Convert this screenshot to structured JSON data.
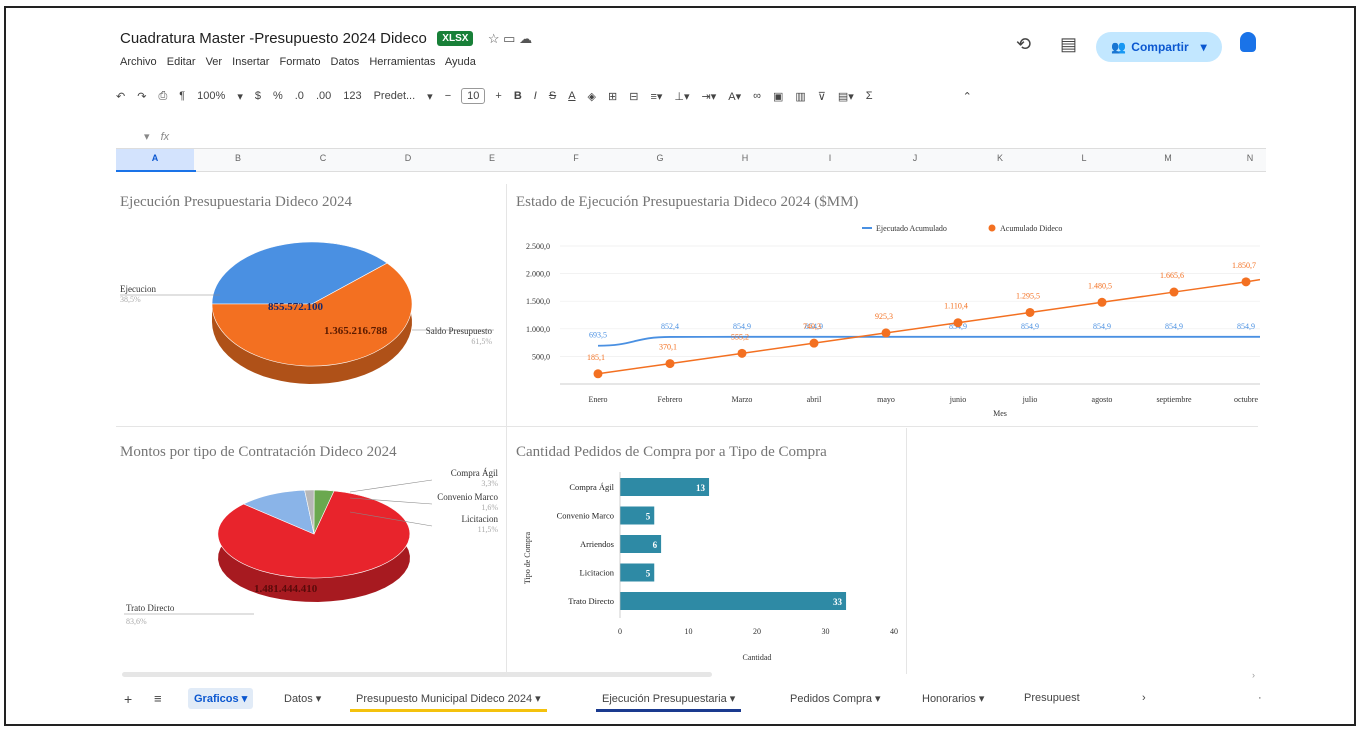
{
  "doc": {
    "title": "Cuadratura Master -Presupuesto 2024 Dideco",
    "file_badge": "XLSX",
    "menu": [
      "Archivo",
      "Editar",
      "Ver",
      "Insertar",
      "Formato",
      "Datos",
      "Herramientas",
      "Ayuda"
    ],
    "share_label": "Compartir"
  },
  "toolbar": {
    "zoom": "100%",
    "currency": "$",
    "percent": "%",
    "dec_less": ".0",
    "dec_more": ".00",
    "number_fmt": "123",
    "font": "Predet...",
    "font_size": "10",
    "sum": "Σ"
  },
  "formula_bar": {
    "fx": "fx"
  },
  "columns": [
    "A",
    "B",
    "C",
    "D",
    "E",
    "F",
    "G",
    "H",
    "I",
    "J",
    "K",
    "L",
    "M",
    "N"
  ],
  "sheet_tabs": [
    {
      "label": "Graficos",
      "active": true
    },
    {
      "label": "Datos"
    },
    {
      "label": "Presupuesto Municipal Dideco 2024",
      "underline": "#f4c20d"
    },
    {
      "label": "Ejecución Presupuestaria",
      "underline": "#1a3a8f"
    },
    {
      "label": "Pedidos Compra"
    },
    {
      "label": "Honorarios"
    },
    {
      "label": "Presupuest"
    }
  ],
  "colors": {
    "blue": "#4a90e2",
    "orange": "#f37021",
    "red": "#e8242c",
    "teal": "#2e8aa5",
    "green": "#6aa84f",
    "share_bg": "#c2e7ff"
  },
  "chart_data": [
    {
      "type": "pie",
      "title": "Ejecución Presupuestaria Dideco 2024",
      "slices": [
        {
          "label": "Ejecucion",
          "value": 855572100,
          "display": "855.572.100",
          "percent": "38,5%"
        },
        {
          "label": "Saldo Presupuesto",
          "value": 1365216788,
          "display": "1.365.216.788",
          "percent": "61,5%"
        }
      ]
    },
    {
      "type": "line",
      "title": "Estado de Ejecución Presupuestaria Dideco 2024 ($MM)",
      "xlabel": "Mes",
      "ylabel": "",
      "categories": [
        "Enero",
        "Febrero",
        "Marzo",
        "abril",
        "mayo",
        "junio",
        "julio",
        "agosto",
        "septiembre",
        "octubre"
      ],
      "y_ticks": [
        "500,0",
        "1.000,0",
        "1.500,0",
        "2.000,0",
        "2.500,0"
      ],
      "ylim": [
        0,
        2500
      ],
      "legend_position": "top-right",
      "series": [
        {
          "name": "Ejecutado Acumulado",
          "values": [
            693.5,
            852.4,
            854.9,
            854.9,
            854.9,
            854.9,
            854.9,
            854.9,
            854.9,
            854.9
          ],
          "labels": [
            "693,5",
            "852,4",
            "854,9",
            "854,9",
            "",
            "854,9",
            "854,9",
            "854,9",
            "854,9",
            "854,9"
          ]
        },
        {
          "name": "Acumulado Dideco",
          "values": [
            185.1,
            370.1,
            555.2,
            740.3,
            925.3,
            1110.4,
            1295.5,
            1480.5,
            1665.6,
            1850.7
          ],
          "labels": [
            "185,1",
            "370,1",
            "555,2",
            "740,3",
            "925,3",
            "1.110,4",
            "1.295,5",
            "1.480,5",
            "1.665,6",
            "1.850,7"
          ]
        }
      ]
    },
    {
      "type": "pie",
      "title": "Montos por tipo de Contratación Dideco 2024",
      "slices": [
        {
          "label": "Trato Directo",
          "display": "1.481.444.410",
          "percent": "83,6%",
          "value": 83.6
        },
        {
          "label": "Licitacion",
          "percent": "11,5%",
          "value": 11.5
        },
        {
          "label": "Convenio Marco",
          "percent": "1,6%",
          "value": 1.6
        },
        {
          "label": "Compra Ágil",
          "percent": "3,3%",
          "value": 3.3
        }
      ]
    },
    {
      "type": "bar",
      "orientation": "horizontal",
      "title": "Cantidad Pedidos de Compra por a Tipo de Compra",
      "xlabel": "Cantidad",
      "ylabel": "Tipo de Compra",
      "categories": [
        "Compra Ágil",
        "Convenio Marco",
        "Arriendos",
        "Licitacion",
        "Trato Directo"
      ],
      "values": [
        13,
        5,
        6,
        5,
        33
      ],
      "x_ticks": [
        0,
        10,
        20,
        30,
        40
      ],
      "xlim": [
        0,
        40
      ]
    }
  ]
}
